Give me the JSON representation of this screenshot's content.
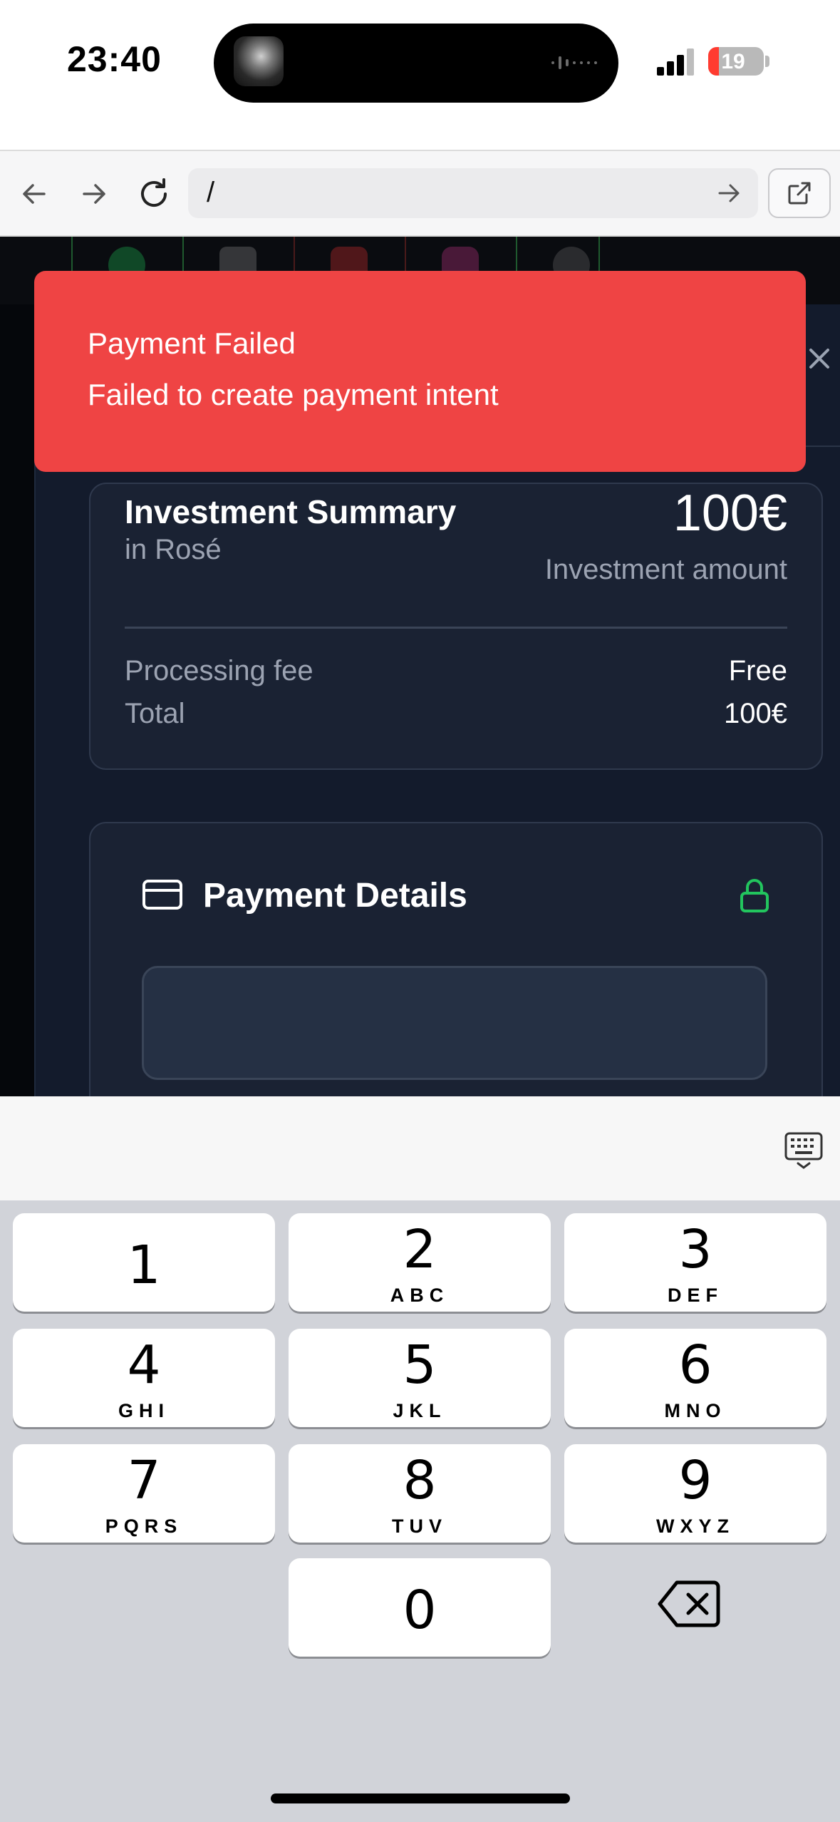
{
  "status_bar": {
    "time": "23:40",
    "battery_level": "19",
    "battery_color": "#ff3b30"
  },
  "browser": {
    "url": "/",
    "icons": [
      "back-arrow-icon",
      "forward-arrow-icon",
      "reload-icon",
      "go-arrow-icon",
      "open-external-icon"
    ]
  },
  "toast": {
    "title": "Payment Failed",
    "message": "Failed to create payment intent",
    "color": "#ef4444"
  },
  "summary": {
    "title": "Investment Summary",
    "subtitle": "in Rosé",
    "amount": "100€",
    "amount_label": "Investment amount",
    "fee_label": "Processing fee",
    "fee_value": "Free",
    "total_label": "Total",
    "total_value": "100€"
  },
  "payment": {
    "title": "Payment Details",
    "lock_color": "#22c55e"
  },
  "keyboard": {
    "keys": [
      {
        "num": "1",
        "letters": ""
      },
      {
        "num": "2",
        "letters": "ABC"
      },
      {
        "num": "3",
        "letters": "DEF"
      },
      {
        "num": "4",
        "letters": "GHI"
      },
      {
        "num": "5",
        "letters": "JKL"
      },
      {
        "num": "6",
        "letters": "MNO"
      },
      {
        "num": "7",
        "letters": "PQRS"
      },
      {
        "num": "8",
        "letters": "TUV"
      },
      {
        "num": "9",
        "letters": "WXYZ"
      },
      {
        "num": "0",
        "letters": ""
      }
    ]
  }
}
